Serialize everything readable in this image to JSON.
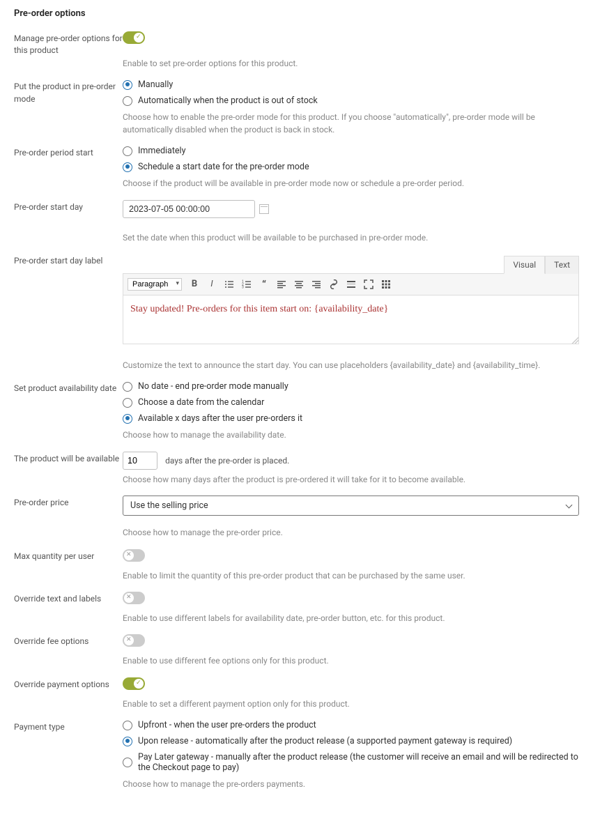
{
  "title": "Pre-order options",
  "fields": {
    "manage": {
      "label": "Manage pre-order options for this product",
      "on": true,
      "help": "Enable to set pre-order options for this product."
    },
    "mode": {
      "label": "Put the product in pre-order mode",
      "options": [
        {
          "label": "Manually",
          "checked": true
        },
        {
          "label": "Automatically when the product is out of stock",
          "checked": false
        }
      ],
      "help": "Choose how to enable the pre-order mode for this product.   If you choose \"automatically\", pre-order mode will be automatically disabled when the product is back in stock."
    },
    "period_start": {
      "label": "Pre-order period start",
      "options": [
        {
          "label": "Immediately",
          "checked": false
        },
        {
          "label": "Schedule a start date for the pre-order mode",
          "checked": true
        }
      ],
      "help": "Choose if the product will be available in pre-order mode now or schedule a pre-order period."
    },
    "start_day": {
      "label": "Pre-order start day",
      "value": "2023-07-05 00:00:00",
      "help": "Set the date when this product will be available to be purchased in pre-order mode."
    },
    "start_day_label": {
      "label": "Pre-order start day label",
      "tabs": {
        "visual": "Visual",
        "text": "Text"
      },
      "format_select": "Paragraph",
      "content": "Stay updated! Pre-orders for this item start on: {availability_date}",
      "help": "Customize the text to announce the start day. You can use placeholders {availability_date} and {availability_time}."
    },
    "availability": {
      "label": "Set product availability date",
      "options": [
        {
          "label": "No date - end pre-order mode manually",
          "checked": false
        },
        {
          "label": "Choose a date from the calendar",
          "checked": false
        },
        {
          "label": "Available x days after the user pre-orders it",
          "checked": true
        }
      ],
      "help": "Choose how to manage the availability date."
    },
    "available_after": {
      "label": "The product will be available",
      "value": "10",
      "suffix": "days after the pre-order is placed.",
      "help": "Choose how many days after the product is pre-ordered it will take for it to become available."
    },
    "price": {
      "label": "Pre-order price",
      "value": "Use the selling price",
      "help": "Choose how to manage the pre-order price."
    },
    "max_qty": {
      "label": "Max quantity per user",
      "on": false,
      "help": "Enable to limit the quantity of this pre-order product that can be purchased by the same user."
    },
    "override_text": {
      "label": "Override text and labels",
      "on": false,
      "help": "Enable to use different labels for availability date, pre-order button, etc. for this product."
    },
    "override_fee": {
      "label": "Override fee options",
      "on": false,
      "help": "Enable to use different fee options only for this product."
    },
    "override_payment": {
      "label": "Override payment options",
      "on": true,
      "help": "Enable to set a different payment option only for this product."
    },
    "payment_type": {
      "label": "Payment type",
      "options": [
        {
          "label": "Upfront - when the user pre-orders the product",
          "checked": false
        },
        {
          "label": "Upon release - automatically after the product release (a supported payment gateway is required)",
          "checked": true
        },
        {
          "label": "Pay Later gateway - manually after the product release (the customer will receive an email and will be redirected to the Checkout page to pay)",
          "checked": false
        }
      ],
      "help": "Choose how to manage the pre-orders payments."
    }
  }
}
